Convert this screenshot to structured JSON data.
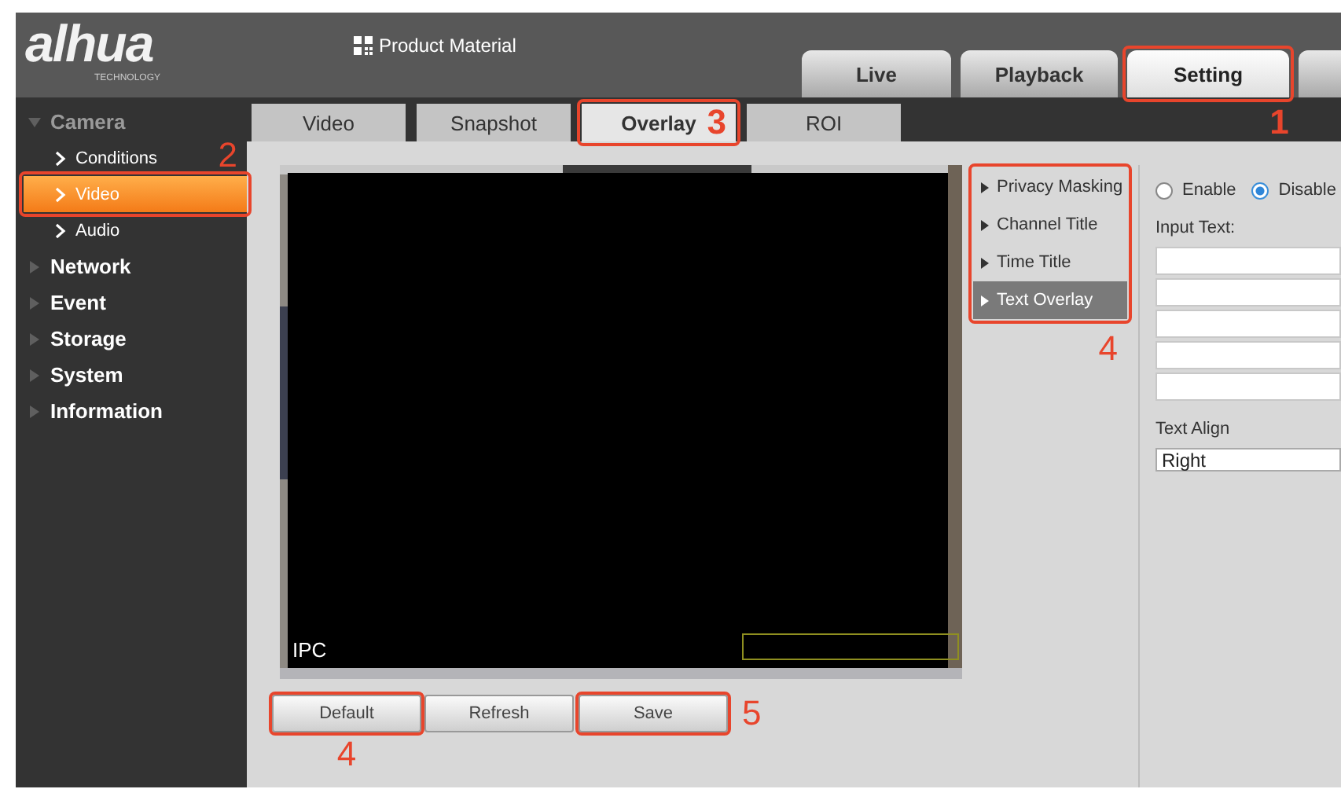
{
  "header": {
    "logo": "alhua",
    "logo_subtitle": "TECHNOLOGY",
    "product_link": "Product Material"
  },
  "top_tabs": [
    {
      "label": "Live",
      "selected": false,
      "highlighted": false
    },
    {
      "label": "Playback",
      "selected": false,
      "highlighted": false
    },
    {
      "label": "Setting",
      "selected": true,
      "highlighted": true,
      "step": "1"
    }
  ],
  "sidebar": {
    "items": [
      {
        "label": "Camera",
        "expanded": true,
        "children": [
          {
            "label": "Conditions",
            "selected": false,
            "highlighted": false
          },
          {
            "label": "Video",
            "selected": true,
            "highlighted": true,
            "step": "2"
          },
          {
            "label": "Audio",
            "selected": false,
            "highlighted": false
          }
        ]
      },
      {
        "label": "Network",
        "expanded": false
      },
      {
        "label": "Event",
        "expanded": false
      },
      {
        "label": "Storage",
        "expanded": false
      },
      {
        "label": "System",
        "expanded": false
      },
      {
        "label": "Information",
        "expanded": false
      }
    ]
  },
  "sub_tabs": [
    {
      "label": "Video",
      "selected": false,
      "highlighted": false
    },
    {
      "label": "Snapshot",
      "selected": false,
      "highlighted": false
    },
    {
      "label": "Overlay",
      "selected": true,
      "highlighted": true,
      "step": "3"
    },
    {
      "label": "ROI",
      "selected": false,
      "highlighted": false
    }
  ],
  "preview": {
    "channel_title": "IPC"
  },
  "buttons": [
    {
      "label": "Default",
      "highlighted": true,
      "step": "4"
    },
    {
      "label": "Refresh",
      "highlighted": false
    },
    {
      "label": "Save",
      "highlighted": true,
      "step": "5"
    }
  ],
  "overlay_menu": {
    "highlighted": true,
    "step": "4",
    "items": [
      {
        "label": "Privacy Masking",
        "selected": false
      },
      {
        "label": "Channel Title",
        "selected": false
      },
      {
        "label": "Time Title",
        "selected": false
      },
      {
        "label": "Text Overlay",
        "selected": true
      }
    ]
  },
  "settings": {
    "mode": [
      {
        "label": "Enable",
        "selected": false
      },
      {
        "label": "Disable",
        "selected": true
      }
    ],
    "input_text_label": "Input Text:",
    "input_fields": [
      {
        "disabled": false
      },
      {
        "disabled": false
      },
      {
        "disabled": false
      },
      {
        "disabled": false
      },
      {
        "disabled": false
      }
    ],
    "text_align_label": "Text Align",
    "text_align": {
      "value": "Right"
    }
  }
}
